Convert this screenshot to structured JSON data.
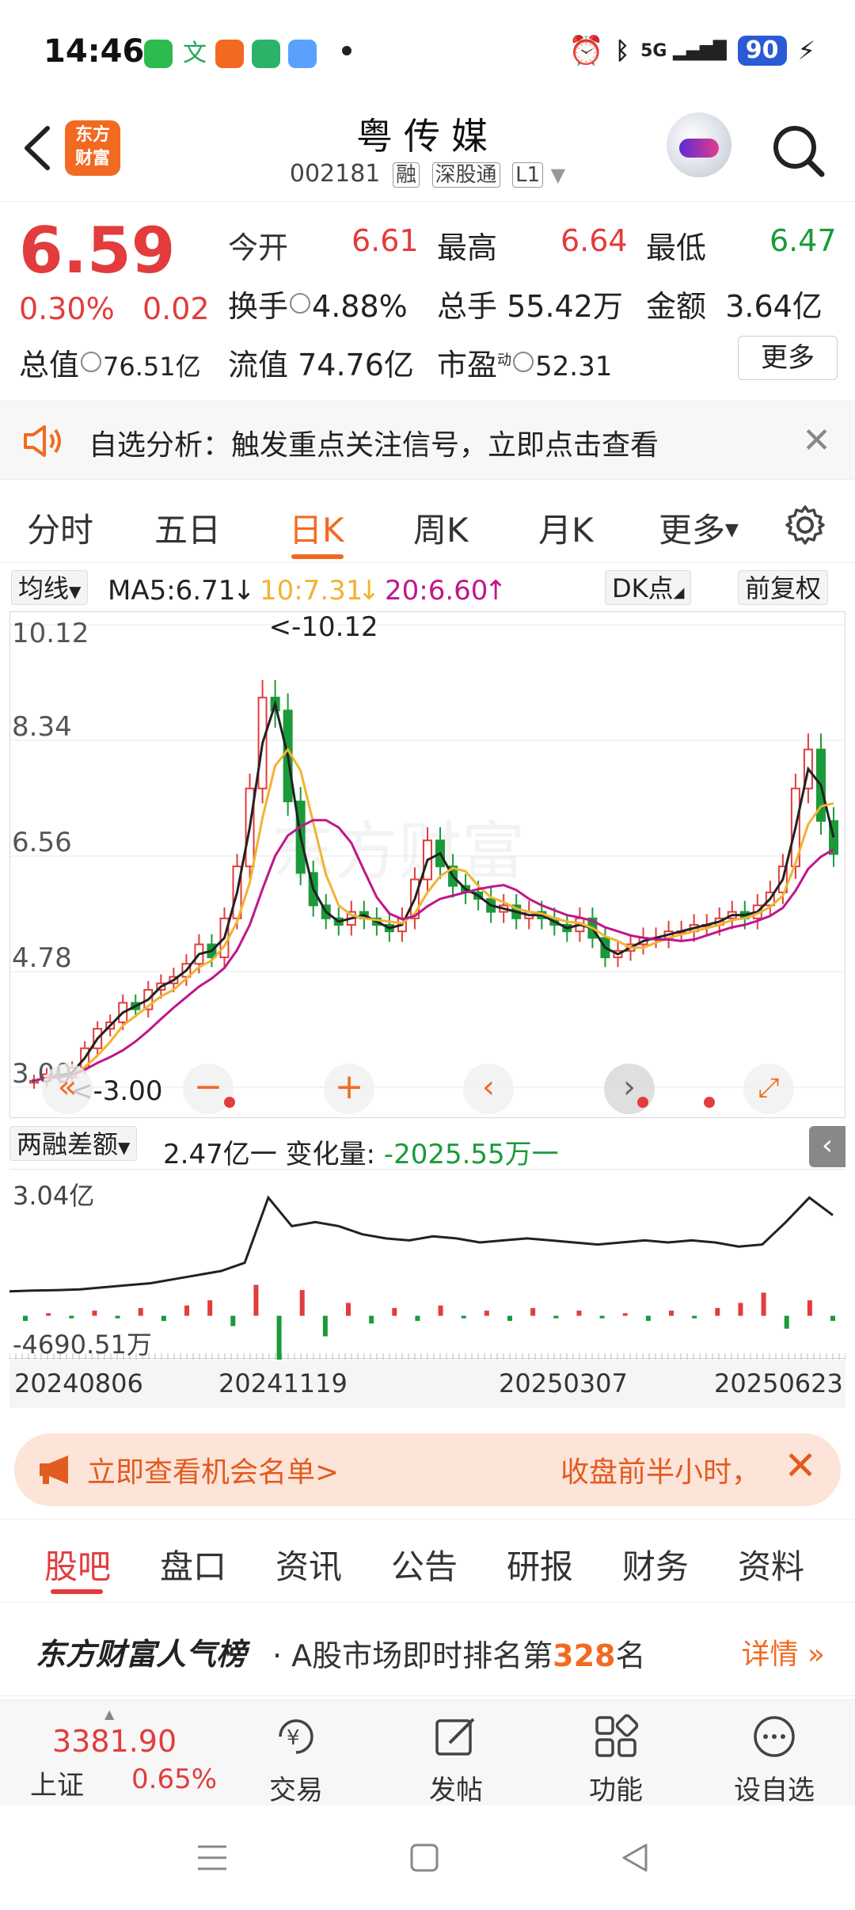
{
  "status_bar": {
    "time": "14:46",
    "battery": "90",
    "network": "5G"
  },
  "header": {
    "logo_text_line1": "东方",
    "logo_text_line2": "财富",
    "stock_name": "粤传媒",
    "stock_code": "002181",
    "tags": [
      "融",
      "深股通",
      "L1"
    ]
  },
  "quote": {
    "price": "6.59",
    "change_pct": "0.30%",
    "change_val": "0.02",
    "open_label": "今开",
    "open": "6.61",
    "high_label": "最高",
    "high": "6.64",
    "low_label": "最低",
    "low": "6.47",
    "turnover_label": "换手",
    "turnover": "4.88%",
    "volume_label": "总手",
    "volume": "55.42万",
    "amount_label": "金额",
    "amount": "3.64亿",
    "mktcap_label": "总值",
    "mktcap": "76.51亿",
    "float_label": "流值",
    "float_cap": "74.76亿",
    "pe_label": "市盈",
    "pe_sup": "动",
    "pe": "52.31",
    "more_label": "更多"
  },
  "notice": {
    "text": "自选分析：触发重点关注信号，立即点击查看"
  },
  "k_tabs": {
    "items": [
      "分时",
      "五日",
      "日K",
      "周K",
      "月K",
      "更多"
    ],
    "active": "日K"
  },
  "ma_row": {
    "indicator": "均线",
    "ma5": "MA5:6.71",
    "ma10": "10:7.31",
    "ma20": "20:6.60",
    "dk": "DK点",
    "adjust": "前复权"
  },
  "main_chart_labels": {
    "y_ticks": [
      "10.12",
      "8.34",
      "6.56",
      "4.78",
      "3.00"
    ],
    "max_marker": "<-10.12",
    "min_marker": "<-3.00"
  },
  "sub_chart": {
    "indicator": "两融差额",
    "value": "2.47亿",
    "change_label": "变化量:",
    "change_value": "-2025.55万",
    "y_top": "3.04亿",
    "y_bottom": "-4690.51万"
  },
  "date_axis": [
    "20240806",
    "20241119",
    "20250307",
    "20250623"
  ],
  "chart_data": {
    "type": "candlestick",
    "ylim": [
      3.0,
      10.12
    ],
    "y_ticks": [
      10.12,
      8.34,
      6.56,
      4.78,
      3.0
    ],
    "x_labels": [
      "20240806",
      "20241119",
      "20250307",
      "20250623"
    ],
    "close_trace": [
      3.1,
      3.2,
      3.15,
      3.3,
      3.6,
      3.9,
      4.0,
      4.3,
      4.2,
      4.5,
      4.6,
      4.7,
      4.9,
      5.2,
      5.0,
      5.6,
      6.4,
      7.6,
      9.0,
      8.8,
      7.4,
      6.3,
      5.8,
      5.6,
      5.5,
      5.7,
      5.6,
      5.5,
      5.4,
      5.6,
      6.2,
      6.8,
      6.4,
      6.1,
      6.0,
      5.9,
      5.7,
      5.8,
      5.6,
      5.7,
      5.6,
      5.5,
      5.4,
      5.6,
      5.3,
      5.0,
      5.1,
      5.2,
      5.3,
      5.3,
      5.4,
      5.4,
      5.5,
      5.5,
      5.6,
      5.7,
      5.6,
      5.8,
      6.0,
      6.4,
      7.6,
      8.2,
      7.1,
      6.59
    ],
    "ma_lines": [
      {
        "name": "MA5",
        "color": "#222222",
        "latest": 6.71
      },
      {
        "name": "MA10",
        "color": "#f0b431",
        "latest": 7.31
      },
      {
        "name": "MA20",
        "color": "#c0168c",
        "latest": 6.6
      }
    ],
    "sub_series": {
      "name": "两融差额",
      "ylim": [
        -0.469,
        3.04
      ],
      "line_trace": [
        0.6,
        0.62,
        0.63,
        0.65,
        0.7,
        0.75,
        0.8,
        0.9,
        1.0,
        1.1,
        1.3,
        2.9,
        2.2,
        2.3,
        2.2,
        2.0,
        1.9,
        1.85,
        1.95,
        1.9,
        1.8,
        1.85,
        1.9,
        1.85,
        1.8,
        1.75,
        1.8,
        1.85,
        1.8,
        1.85,
        1.8,
        1.7,
        1.75,
        2.3,
        2.9,
        2.47
      ],
      "bars": [
        -0.2,
        0.1,
        -0.1,
        0.2,
        -0.1,
        0.3,
        -0.2,
        0.4,
        0.6,
        -0.4,
        1.2,
        -1.8,
        1.0,
        -0.8,
        0.5,
        -0.3,
        0.3,
        -0.2,
        0.4,
        -0.1,
        0.2,
        -0.2,
        0.3,
        -0.1,
        0.2,
        -0.1,
        0.1,
        -0.2,
        0.2,
        -0.1,
        0.3,
        0.5,
        0.9,
        -0.5,
        0.6,
        -0.2
      ]
    }
  },
  "promo": {
    "left_text": "立即查看机会名单>",
    "right_text": "收盘前半小时，"
  },
  "news_tabs": {
    "items": [
      "股吧",
      "盘口",
      "资讯",
      "公告",
      "研报",
      "财务",
      "资料"
    ],
    "active": "股吧"
  },
  "popularity": {
    "brand": "东方财富人气榜",
    "prefix": "· A股市场即时排名第",
    "rank": "328",
    "suffix": "名",
    "detail": "详情"
  },
  "toolbar": {
    "index_value": "3381.90",
    "index_name": "上证",
    "index_change": "0.65%",
    "items": [
      "交易",
      "发帖",
      "功能",
      "设自选"
    ]
  },
  "colors": {
    "up": "#e23c3c",
    "down": "#1a9a3a",
    "accent": "#f26a21"
  }
}
